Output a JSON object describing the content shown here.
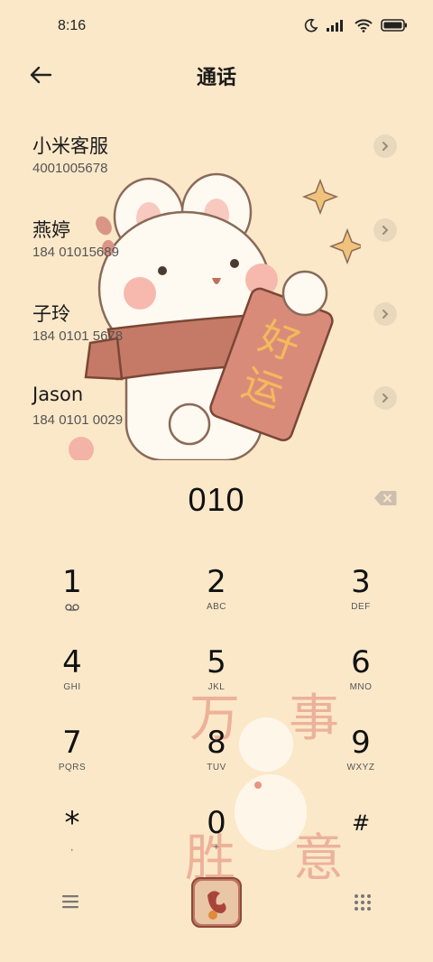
{
  "status_bar": {
    "time": "8:16"
  },
  "header": {
    "title": "通话"
  },
  "contacts": [
    {
      "name": "小米客服",
      "number": "4001005678"
    },
    {
      "name": "燕婷",
      "number": "184 01015689"
    },
    {
      "name": "子玲",
      "number": "184 0101 5678"
    },
    {
      "name": "Jason",
      "number": "184 0101 0029"
    }
  ],
  "dialer": {
    "input": "010"
  },
  "keypad": [
    {
      "digit": "1",
      "letters": ""
    },
    {
      "digit": "2",
      "letters": "ABC"
    },
    {
      "digit": "3",
      "letters": "DEF"
    },
    {
      "digit": "4",
      "letters": "GHI"
    },
    {
      "digit": "5",
      "letters": "JKL"
    },
    {
      "digit": "6",
      "letters": "MNO"
    },
    {
      "digit": "7",
      "letters": "PQRS"
    },
    {
      "digit": "8",
      "letters": "TUV"
    },
    {
      "digit": "9",
      "letters": "WXYZ"
    },
    {
      "digit": "*",
      "letters": ","
    },
    {
      "digit": "0",
      "letters": "+"
    },
    {
      "digit": "#",
      "letters": ""
    }
  ],
  "decoration": {
    "banner_text": "好运",
    "blessing_chars": [
      "万",
      "事",
      "胜",
      "意"
    ]
  },
  "icons": {
    "back": "back-arrow-icon",
    "chevron": "chevron-right-icon",
    "backspace": "backspace-icon",
    "voicemail": "voicemail-icon",
    "menu": "menu-icon",
    "call": "call-icon",
    "dialpad": "dialpad-icon"
  },
  "colors": {
    "background": "#fbe8c9",
    "call_button": "#c0755d",
    "accent_pink": "#e8a08a"
  }
}
